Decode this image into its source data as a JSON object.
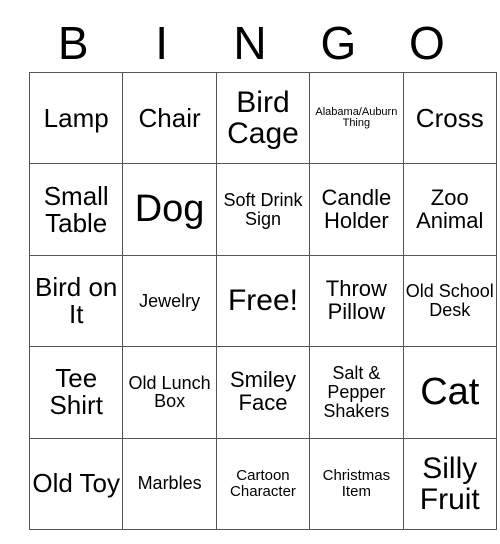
{
  "card": {
    "header_letters": [
      "B",
      "I",
      "N",
      "G",
      "O"
    ],
    "columns": [
      {
        "letter": "B",
        "cells": [
          {
            "text": "Lamp",
            "size": "lg"
          },
          {
            "text": "Small Table",
            "size": "lg"
          },
          {
            "text": "Bird on It",
            "size": "lg"
          },
          {
            "text": "Tee Shirt",
            "size": "lg"
          },
          {
            "text": "Old Toy",
            "size": "lg"
          }
        ]
      },
      {
        "letter": "I",
        "cells": [
          {
            "text": "Chair",
            "size": "lg"
          },
          {
            "text": "Dog",
            "size": "xxl"
          },
          {
            "text": "Jewelry",
            "size": "sm"
          },
          {
            "text": "Old Lunch Box",
            "size": "sm"
          },
          {
            "text": "Marbles",
            "size": "sm"
          }
        ]
      },
      {
        "letter": "N",
        "cells": [
          {
            "text": "Bird Cage",
            "size": "xl"
          },
          {
            "text": "Soft Drink Sign",
            "size": "sm"
          },
          {
            "text": "Free!",
            "size": "xl"
          },
          {
            "text": "Smiley Face",
            "size": "md"
          },
          {
            "text": "Cartoon Character",
            "size": "xs"
          }
        ]
      },
      {
        "letter": "G",
        "cells": [
          {
            "text": "Alabama/Auburn Thing",
            "size": "xxs"
          },
          {
            "text": "Candle Holder",
            "size": "md"
          },
          {
            "text": "Throw Pillow",
            "size": "md"
          },
          {
            "text": "Salt & Pepper Shakers",
            "size": "sm"
          },
          {
            "text": "Christmas Item",
            "size": "xs"
          }
        ]
      },
      {
        "letter": "O",
        "cells": [
          {
            "text": "Cross",
            "size": "lg"
          },
          {
            "text": "Zoo Animal",
            "size": "md"
          },
          {
            "text": "Old School Desk",
            "size": "sm"
          },
          {
            "text": "Cat",
            "size": "xxl"
          },
          {
            "text": "Silly Fruit",
            "size": "xl"
          }
        ]
      }
    ]
  },
  "colors": {
    "background": "#ffffff",
    "text": "#000000",
    "grid_line": "#555555"
  }
}
